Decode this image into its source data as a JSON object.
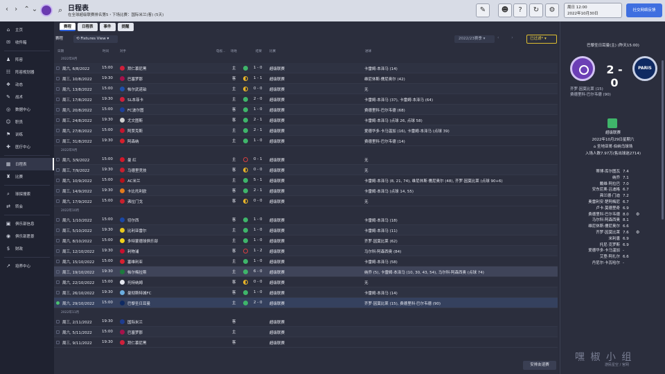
{
  "topbar": {
    "title": "日程表",
    "subtitle": "在全球超级联赛排名第5・下场比赛：国际米兰(客) (5天)",
    "date_line1": "周日 12:00",
    "date_line2": "2022年10月30日",
    "social_btn": "社交网络反馈"
  },
  "sidebar": {
    "items": [
      {
        "label": "主页",
        "icon": "home-icon"
      },
      {
        "label": "收件箱",
        "icon": "inbox-icon"
      },
      {
        "label": "阵容",
        "icon": "squad-icon"
      },
      {
        "label": "阵容规划器",
        "icon": "planner-icon"
      },
      {
        "label": "动态",
        "icon": "dynamics-icon"
      },
      {
        "label": "战术",
        "icon": "tactics-icon"
      },
      {
        "label": "数据中心",
        "icon": "data-icon"
      },
      {
        "label": "职员",
        "icon": "staff-icon"
      },
      {
        "label": "训练",
        "icon": "training-icon"
      },
      {
        "label": "医疗中心",
        "icon": "medical-icon"
      },
      {
        "label": "日程表",
        "icon": "calendar-icon"
      },
      {
        "label": "比赛",
        "icon": "trophy-icon"
      },
      {
        "label": "球探搜索",
        "icon": "scout-icon"
      },
      {
        "label": "转会",
        "icon": "transfer-icon"
      },
      {
        "label": "俱乐部信息",
        "icon": "club-info-icon"
      },
      {
        "label": "俱乐部愿景",
        "icon": "vision-icon"
      },
      {
        "label": "财政",
        "icon": "finance-icon"
      },
      {
        "label": "培养中心",
        "icon": "development-icon"
      }
    ]
  },
  "tabs": [
    "赛程",
    "日程表",
    "事件",
    "提醒"
  ],
  "filterbar": {
    "label": "赛程",
    "view": "Fixtures View",
    "season": "2022/23赛季",
    "filter": "已过滤*"
  },
  "columns": {
    "date": "日期",
    "time": "时间",
    "opponent": "对手",
    "tv": "电视...",
    "venue": "场地",
    "result": "结果",
    "comp": "比赛",
    "scorers": "进球"
  },
  "months": [
    "2022年8月",
    "2022年9月",
    "2022年10月",
    "2022年11月"
  ],
  "fixtures": [
    {
      "m": 0,
      "date": "周六, 6/8/2022",
      "time": "15:00",
      "opp": "拜仁慕尼黑",
      "crest": "#d0203b",
      "venue": "主",
      "res": "W",
      "score": "1 - 0",
      "comp": "超级联赛",
      "scorers": "卡雷姆·本泽马 (14)"
    },
    {
      "m": 0,
      "date": "周三, 10/8/2022",
      "time": "19:30",
      "opp": "巴塞罗那",
      "crest": "#a5124b",
      "venue": "客",
      "res": "D",
      "score": "1 - 1",
      "comp": "超级联赛",
      "scorers": "维尼休斯·儒尼奥尔 (42)"
    },
    {
      "m": 0,
      "date": "周六, 13/8/2022",
      "time": "15:00",
      "opp": "帕尔武诺铂",
      "crest": "#1f4fa8",
      "venue": "主",
      "res": "D",
      "score": "0 - 0",
      "comp": "超级联赛",
      "scorers": "无"
    },
    {
      "m": 0,
      "date": "周三, 17/8/2022",
      "time": "19:30",
      "opp": "SL本菲卡",
      "crest": "#d0203b",
      "venue": "主",
      "res": "W",
      "score": "2 - 0",
      "comp": "超级联赛",
      "scorers": "卡雷姆·本泽马 (37), 卡雷姆·本泽马 (64)"
    },
    {
      "m": 0,
      "date": "周六, 20/8/2022",
      "time": "15:00",
      "opp": "FC波尔图",
      "crest": "#1d3f9a",
      "venue": "客",
      "res": "W",
      "score": "1 - 0",
      "comp": "超级联赛",
      "scorers": "费德里科·巴尔韦德 (68)"
    },
    {
      "m": 0,
      "date": "周三, 24/8/2022",
      "time": "19:30",
      "opp": "尤文图斯",
      "crest": "#cfcfcf",
      "venue": "客",
      "res": "W",
      "score": "2 - 1",
      "comp": "超级联赛",
      "scorers": "卡雷姆·本泽马 (点球 26, 点球 58)"
    },
    {
      "m": 0,
      "date": "周六, 27/8/2022",
      "time": "15:00",
      "opp": "阿贾克斯",
      "crest": "#c4162e",
      "venue": "主",
      "res": "W",
      "score": "2 - 1",
      "comp": "超级联赛",
      "scorers": "爱德华多·卡马温加 (16), 卡雷姆·本泽马 (点球 39)"
    },
    {
      "m": 0,
      "date": "周三, 31/8/2022",
      "time": "19:30",
      "opp": "阿森纳",
      "crest": "#d61f2c",
      "venue": "主",
      "res": "W",
      "score": "1 - 0",
      "comp": "超级联赛",
      "scorers": "费德里科·巴尔韦德 (14)"
    },
    {
      "m": 1,
      "date": "周六, 3/9/2022",
      "time": "15:00",
      "opp": "曼 红",
      "crest": "#d1182a",
      "venue": "主",
      "res": "L",
      "score": "0 - 1",
      "comp": "超级联赛",
      "scorers": "无"
    },
    {
      "m": 1,
      "date": "周三, 7/9/2022",
      "time": "19:30",
      "opp": "马德里竞技",
      "crest": "#c8202f",
      "venue": "客",
      "res": "D",
      "score": "0 - 0",
      "comp": "超级联赛",
      "scorers": "无"
    },
    {
      "m": 1,
      "date": "周六, 10/9/2022",
      "time": "15:00",
      "opp": "AC米兰",
      "crest": "#b5121b",
      "venue": "主",
      "res": "W",
      "score": "5 - 1",
      "comp": "超级联赛",
      "scorers": "卡雷姆·本泽马 (8, 21, 74), 维尼休斯·儒尼奥尔 (48), 齐罗·因莫比莱 (点球 90+6)"
    },
    {
      "m": 1,
      "date": "周三, 14/9/2022",
      "time": "19:30",
      "opp": "卡比托利欧",
      "crest": "#e27b1e",
      "venue": "客",
      "res": "W",
      "score": "2 - 1",
      "comp": "超级联赛",
      "scorers": "卡雷姆·本泽马 (点球 14, 55)"
    },
    {
      "m": 1,
      "date": "周六, 17/9/2022",
      "time": "15:00",
      "opp": "弗拉门戈",
      "crest": "#c7202d",
      "venue": "客",
      "res": "D",
      "score": "0 - 0",
      "comp": "超级联赛",
      "scorers": "无"
    },
    {
      "m": 2,
      "date": "周六, 1/10/2022",
      "time": "15:00",
      "opp": "切尔西",
      "crest": "#1a48a6",
      "venue": "客",
      "res": "W",
      "score": "1 - 0",
      "comp": "超级联赛",
      "scorers": "卡雷姆·本泽马 (18)"
    },
    {
      "m": 2,
      "date": "周三, 5/10/2022",
      "time": "19:30",
      "opp": "比利亚雷尔",
      "crest": "#e8c81f",
      "venue": "主",
      "res": "W",
      "score": "1 - 0",
      "comp": "超级联赛",
      "scorers": "卡雷姆·本泽马 (11)"
    },
    {
      "m": 2,
      "date": "周六, 8/10/2022",
      "time": "15:00",
      "opp": "多特蒙德球俱乐部",
      "crest": "#f2d21c",
      "venue": "主",
      "res": "W",
      "score": "1 - 0",
      "comp": "超级联赛",
      "scorers": "齐罗·因莫比莱 (62)"
    },
    {
      "m": 2,
      "date": "周三, 12/10/2022",
      "time": "19:30",
      "opp": "利物浦",
      "crest": "#c8102e",
      "venue": "客",
      "res": "L",
      "score": "1 - 2",
      "comp": "超级联赛",
      "scorers": "马尔科·阿森西奥 (84)"
    },
    {
      "m": 2,
      "date": "周六, 15/10/2022",
      "time": "15:00",
      "opp": "塞维利亚",
      "crest": "#d8202f",
      "venue": "主",
      "res": "W",
      "score": "1 - 0",
      "comp": "超级联赛",
      "scorers": "卡雷姆·本泽马 (58)"
    },
    {
      "m": 2,
      "date": "周三, 19/10/2022",
      "time": "19:30",
      "opp": "帕尔梅拉斯",
      "crest": "#1c7a3c",
      "venue": "主",
      "res": "W",
      "score": "6 - 0",
      "comp": "超级联赛",
      "scorers": "纳乔 (5), 卡雷姆·本泽马 (10, 30, 43, 54), 马尔科·阿森西奥 (点球 74)"
    },
    {
      "m": 2,
      "date": "周六, 22/10/2022",
      "time": "15:00",
      "opp": "托特纳姆",
      "crest": "#e6e8ef",
      "venue": "客",
      "res": "D",
      "score": "0 - 0",
      "comp": "超级联赛",
      "scorers": "无"
    },
    {
      "m": 2,
      "date": "周三, 26/10/2022",
      "time": "19:30",
      "opp": "曼彻斯特城FC",
      "crest": "#6caee0",
      "venue": "客",
      "res": "W",
      "score": "1 - 0",
      "comp": "超级联赛",
      "scorers": "卡雷姆·本泽马 (14)"
    },
    {
      "m": 2,
      "date": "周六, 29/10/2022",
      "time": "15:00",
      "opp": "巴黎圣日耳曼",
      "crest": "#0f2a62",
      "venue": "主",
      "res": "W",
      "score": "2 - 0",
      "comp": "超级联赛",
      "scorers": "齐罗·因莫比莱 (15), 费德里科·巴尔韦德 (90)",
      "next": true
    },
    {
      "m": 3,
      "date": "周三, 2/11/2022",
      "time": "19:30",
      "opp": "国际米兰",
      "crest": "#1e3c8f",
      "venue": "客",
      "res": "",
      "score": "",
      "comp": "超级联赛",
      "scorers": ""
    },
    {
      "m": 3,
      "date": "周六, 5/11/2022",
      "time": "15:00",
      "opp": "巴塞罗那",
      "crest": "#a5124b",
      "venue": "主",
      "res": "",
      "score": "",
      "comp": "超级联赛",
      "scorers": ""
    },
    {
      "m": 3,
      "date": "周三, 9/11/2022",
      "time": "19:30",
      "opp": "拜仁慕尼黑",
      "crest": "#d0203b",
      "venue": "客",
      "res": "",
      "score": "",
      "comp": "超级联赛",
      "scorers": ""
    }
  ],
  "footer_btn": "安排友谊赛",
  "match": {
    "header": "巴黎圣日耳曼(主) (昨天15:00)",
    "score": "2 - 0",
    "away_logo_text": "PARIS",
    "scorers": [
      "齐罗·因莫比莱 (15)",
      "费德里科·巴尔韦德 (90)"
    ],
    "comp": "超级联赛",
    "date": "2022年10月29日星期六",
    "stadium": "圣地亚哥·伯纳乌球场",
    "attendance": "入场人数7.97万(售出球迷2714)"
  },
  "ratings": [
    {
      "name": "蒂博·库尔图瓦",
      "v": "7.4",
      "star": ""
    },
    {
      "name": "纳乔",
      "v": "7.1",
      "star": ""
    },
    {
      "name": "戴维·阿拉巴",
      "v": "7.0",
      "star": ""
    },
    {
      "name": "安东尼奥·吕迪格",
      "v": "6.7",
      "star": ""
    },
    {
      "name": "弗兰德·门迪",
      "v": "7.2",
      "star": ""
    },
    {
      "name": "奥雷利安·楚阿梅尼",
      "v": "6.7",
      "star": ""
    },
    {
      "name": "卢卡·莫德里奇",
      "v": "6.9",
      "star": ""
    },
    {
      "name": "费德里科·巴尔韦德",
      "v": "8.0",
      "star": "⚙"
    },
    {
      "name": "马尔科·阿森西奥",
      "v": "8.1",
      "star": ""
    },
    {
      "name": "维尼休斯·儒尼奥尔",
      "v": "6.6",
      "star": ""
    },
    {
      "name": "齐罗·因莫比莱",
      "v": "7.6",
      "star": "⚙"
    },
    {
      "name": "米利唐",
      "v": "6.9",
      "star": ""
    },
    {
      "name": "托尼·克罗斯",
      "v": "6.9",
      "star": ""
    },
    {
      "name": "爱德华多·卡马温加",
      "v": "-",
      "star": ""
    },
    {
      "name": "艾登·阿扎尔",
      "v": "6.6",
      "star": ""
    },
    {
      "name": "丹尼尔·卡瓦哈尔",
      "v": "-",
      "star": ""
    }
  ],
  "watermark": {
    "big": "嘿 椒 小 组",
    "small": "游民星空 / 官网"
  }
}
